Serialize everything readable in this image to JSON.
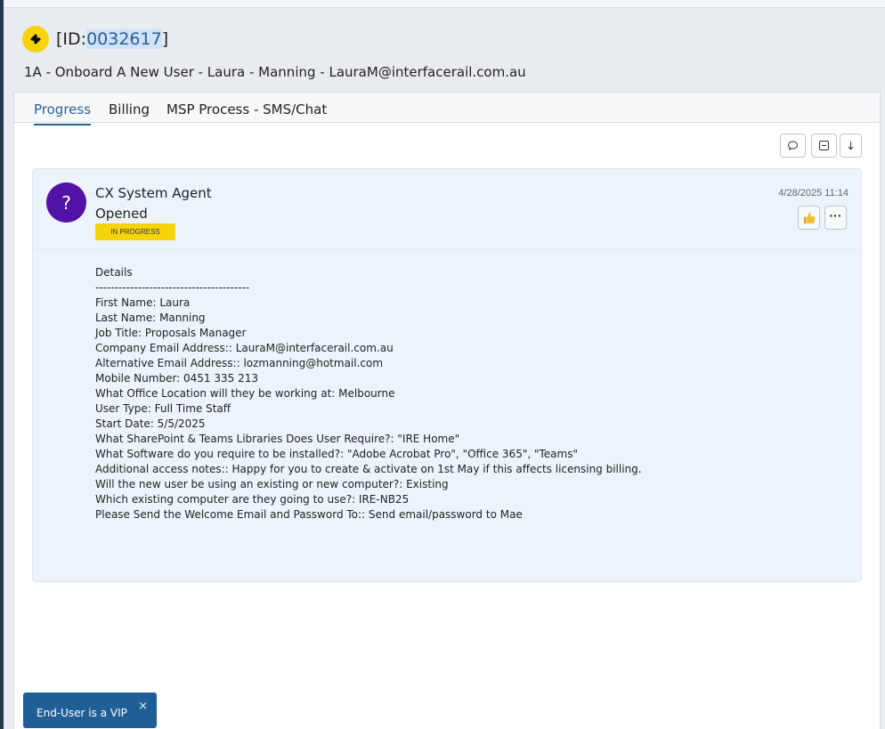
{
  "ticket": {
    "id_prefix": "[ID:",
    "id_number": "0032617",
    "id_suffix": "]",
    "title": "1A - Onboard A New User - Laura - Manning - LauraM@interfacerail.com.au"
  },
  "tabs": [
    {
      "label": "Progress",
      "active": true
    },
    {
      "label": "Billing",
      "active": false
    },
    {
      "label": "MSP Process - SMS/Chat",
      "active": false
    }
  ],
  "toolbar": {
    "icons": [
      "comment-icon",
      "collapse-icon",
      "sort-down-icon"
    ]
  },
  "entry": {
    "avatar_initial": "?",
    "author": "CX System Agent",
    "action": "Opened",
    "status": "IN PROGRESS",
    "timestamp": "4/28/2025 11:14",
    "avatar_color": "#5312a6",
    "status_color": "#f6d40b",
    "details": [
      "Details",
      "----------------------------------------",
      "First Name: Laura",
      "Last Name: Manning",
      "Job Title: Proposals Manager",
      "Company Email Address:: LauraM@interfacerail.com.au",
      "Alternative Email Address:: lozmanning@hotmail.com",
      "Mobile Number: 0451 335 213",
      "What Office Location will they be working at: Melbourne",
      "User Type: Full Time Staff",
      "Start Date: 5/5/2025",
      "What SharePoint & Teams Libraries Does User Require?: \"IRE Home\"",
      "What Software do you require to be installed?: \"Adobe Acrobat Pro\", \"Office 365\", \"Teams\"",
      "Additional access notes:: Happy for you to create & activate on 1st May if this affects licensing billing.",
      "Will the new user be using an existing or new computer?: Existing",
      "Which existing computer are they going to use?: IRE-NB25",
      "Please Send the Welcome Email and Password To:: Send email/password to Mae"
    ]
  },
  "toast": {
    "message": "End-User is a VIP",
    "close": "×",
    "color": "#1f5f96"
  }
}
